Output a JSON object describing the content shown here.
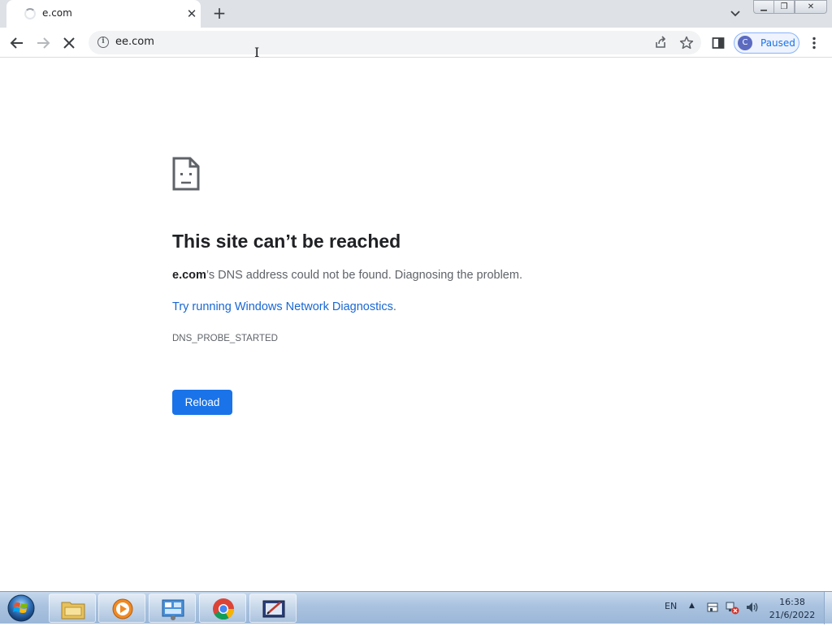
{
  "browser": {
    "tab": {
      "title": "e.com",
      "close_icon": "close-icon",
      "loading": true
    },
    "new_tab_icon": "plus-icon",
    "tab_search_icon": "chevron-down-icon",
    "window_controls": {
      "minimize": "minimize-icon",
      "maximize": "maximize-icon",
      "close": "close-icon"
    },
    "toolbar": {
      "back_icon": "back-arrow-icon",
      "forward_icon": "forward-arrow-icon",
      "stop_icon": "stop-icon",
      "url": "ee.com",
      "site_info_icon": "info-icon",
      "share_icon": "share-icon",
      "bookmark_icon": "star-icon",
      "side_panel_icon": "side-panel-icon",
      "profile": {
        "initial": "C",
        "status": "Paused"
      },
      "menu_icon": "kebab-menu-icon"
    }
  },
  "error_page": {
    "icon": "sad-page-icon",
    "title": "This site can’t be reached",
    "host": "e.com",
    "message_suffix": "’s DNS address could not be found. Diagnosing the problem.",
    "link_text": "Try running Windows Network Diagnostics",
    "link_suffix": ".",
    "error_code": "DNS_PROBE_STARTED",
    "reload_label": "Reload"
  },
  "taskbar": {
    "start_icon": "windows-start-icon",
    "apps": [
      "file-explorer-icon",
      "media-player-icon",
      "control-panel-icon",
      "chrome-icon",
      "pen-tablet-icon"
    ],
    "tray": {
      "language": "EN",
      "time": "16:38",
      "date": "21/6/2022",
      "icons": [
        "show-hidden-icons-icon",
        "action-center-icon",
        "network-error-icon",
        "volume-icon"
      ]
    }
  },
  "colors": {
    "accent": "#1a73e8",
    "link": "#1967d2",
    "title_text": "#202124",
    "body_text": "#5f6368",
    "tabstrip_bg": "#dee1e6"
  }
}
